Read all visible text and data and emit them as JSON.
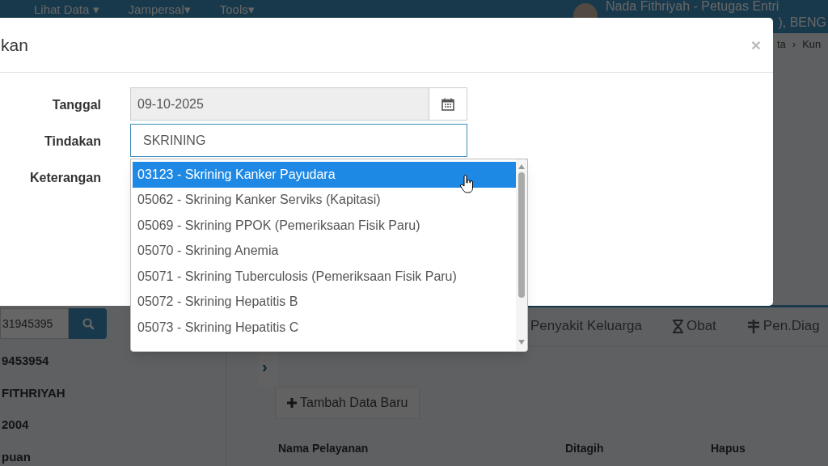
{
  "navbar": {
    "menus": [
      "Lihat Data ▾",
      "Jampersal▾",
      "Tools▾"
    ],
    "user": {
      "name": "Nada Fithriyah - Petugas Entri",
      "detail": "), BENG"
    }
  },
  "breadcrumb": [
    "ta",
    "›",
    "Kun"
  ],
  "sidebar": {
    "search": {
      "value": "31945395"
    },
    "values": [
      "9453954",
      "FITHRIYAH",
      "2004",
      "puan"
    ]
  },
  "tabs": [
    {
      "label": "Penyakit Keluarga"
    },
    {
      "label": "Obat"
    },
    {
      "label": "Pen.Diag"
    }
  ],
  "panel": {
    "toggle": "›",
    "add_button": "Tambah Data Baru",
    "columns": [
      "Nama Pelayanan",
      "Ditagih",
      "Hapus"
    ]
  },
  "modal": {
    "title": "kan",
    "close": "×",
    "fields": [
      {
        "label": "Tanggal",
        "kind": "date",
        "value": "09-10-2025",
        "disabled": true
      },
      {
        "label": "Tindakan",
        "kind": "text",
        "value": "SKRINING",
        "disabled": false
      },
      {
        "label": "Keterangan",
        "kind": "label"
      }
    ],
    "suggestions": [
      {
        "text": "03123 - Skrining Kanker Payudara",
        "selected": true
      },
      {
        "text": "05062 - Skrining Kanker Serviks (Kapitasi)",
        "selected": false
      },
      {
        "text": "05069 - Skrining PPOK (Pemeriksaan Fisik Paru)",
        "selected": false
      },
      {
        "text": "05070 - Skrining Anemia",
        "selected": false
      },
      {
        "text": "05071 - Skrining Tuberculosis (Pemeriksaan Fisik Paru)",
        "selected": false
      },
      {
        "text": "05072 - Skrining Hepatitis B",
        "selected": false
      },
      {
        "text": "05073 - Skrining Hepatitis C",
        "selected": false
      }
    ]
  }
}
